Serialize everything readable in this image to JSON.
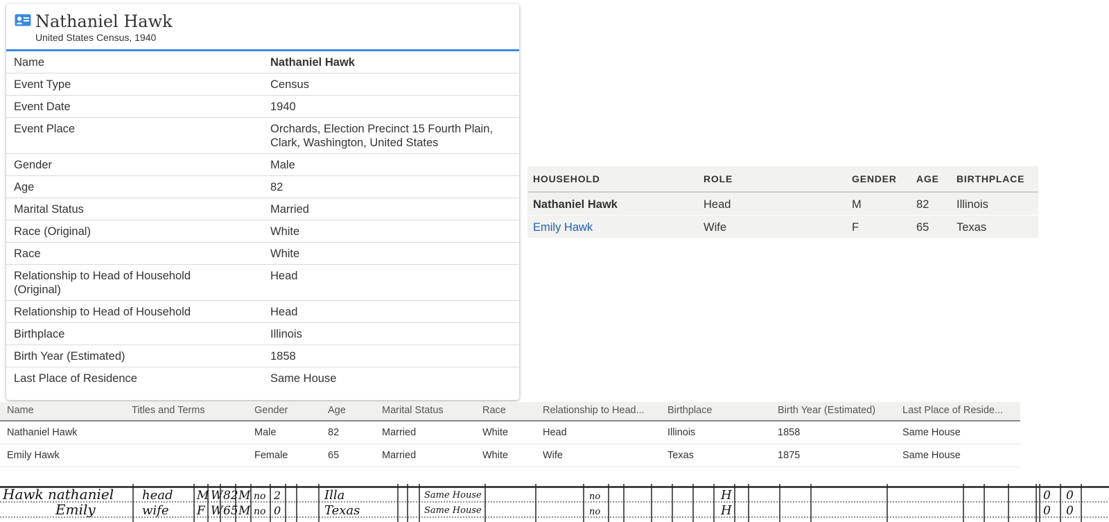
{
  "record": {
    "title": "Nathaniel Hawk",
    "subtitle": "United States Census, 1940",
    "icon": "person-card-icon",
    "accent_color": "#3a8be0",
    "fields": [
      {
        "label": "Name",
        "value": "Nathaniel Hawk"
      },
      {
        "label": "Event Type",
        "value": "Census"
      },
      {
        "label": "Event Date",
        "value": "1940"
      },
      {
        "label": "Event Place",
        "value": "Orchards, Election Precinct 15 Fourth Plain, Clark, Washington, United States"
      },
      {
        "label": "Gender",
        "value": "Male"
      },
      {
        "label": "Age",
        "value": "82"
      },
      {
        "label": "Marital Status",
        "value": "Married"
      },
      {
        "label": "Race (Original)",
        "value": "White"
      },
      {
        "label": "Race",
        "value": "White"
      },
      {
        "label": "Relationship to Head of Household (Original)",
        "value": "Head"
      },
      {
        "label": "Relationship to Head of Household",
        "value": "Head"
      },
      {
        "label": "Birthplace",
        "value": "Illinois"
      },
      {
        "label": "Birth Year (Estimated)",
        "value": "1858"
      },
      {
        "label": "Last Place of Residence",
        "value": "Same House"
      }
    ]
  },
  "household": {
    "headers": [
      "HOUSEHOLD",
      "ROLE",
      "GENDER",
      "AGE",
      "BIRTHPLACE"
    ],
    "rows": [
      {
        "name": "Nathaniel Hawk",
        "role": "Head",
        "gender": "M",
        "age": "82",
        "birthplace": "Illinois"
      },
      {
        "name": "Emily Hawk",
        "role": "Wife",
        "gender": "F",
        "age": "65",
        "birthplace": "Texas"
      }
    ],
    "link_color": "#2060b8"
  },
  "index_table": {
    "headers": [
      "Name",
      "Titles and Terms",
      "Gender",
      "Age",
      "Marital Status",
      "Race",
      "Relationship to Head...",
      "Birthplace",
      "Birth Year (Estimated)",
      "Last Place of Reside..."
    ],
    "rows": [
      [
        "Nathaniel Hawk",
        "",
        "Male",
        "82",
        "Married",
        "White",
        "Head",
        "Illinois",
        "1858",
        "Same House"
      ],
      [
        "Emily Hawk",
        "",
        "Female",
        "65",
        "Married",
        "White",
        "Wife",
        "Texas",
        "1875",
        "Same House"
      ]
    ]
  },
  "census_image": {
    "row1": [
      "Hawk nathaniel",
      "head",
      "M",
      "W",
      "82",
      "M",
      "no",
      "2",
      "Illa",
      "Same House",
      "no",
      "H",
      "0",
      "0"
    ],
    "row2": [
      "Emily",
      "wife",
      "F",
      "W",
      "65",
      "M",
      "no",
      "0",
      "Texas",
      "Same House",
      "no",
      "H",
      "0",
      "0"
    ]
  }
}
